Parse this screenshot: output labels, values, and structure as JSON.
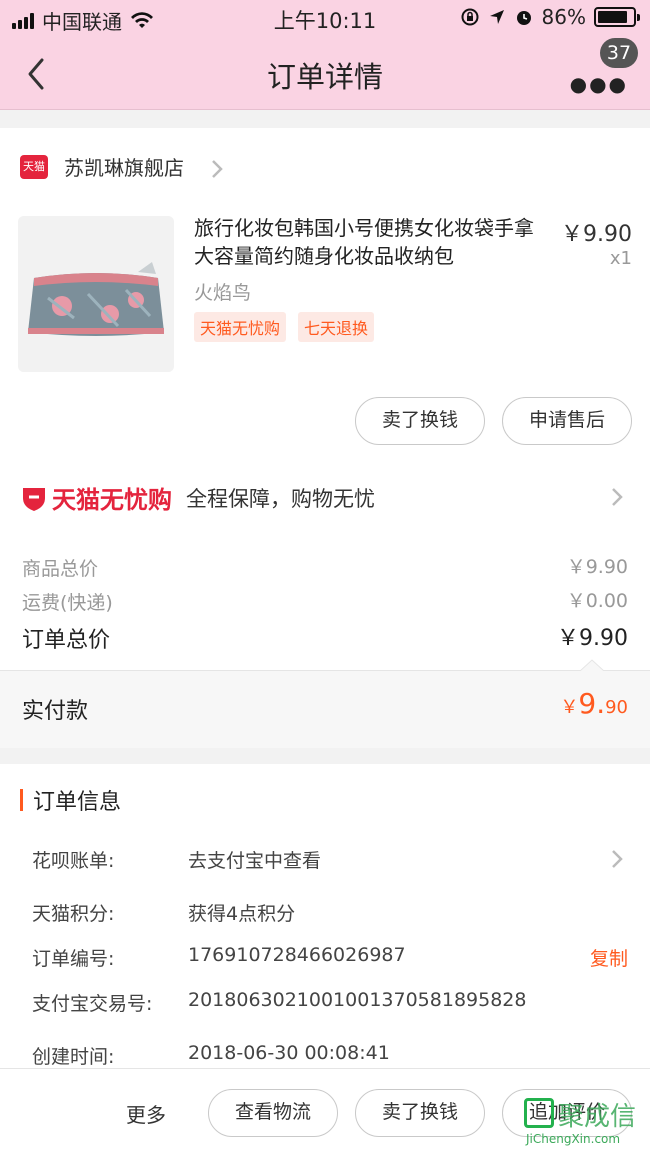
{
  "status_bar": {
    "carrier": "中国联通",
    "time": "上午10:11",
    "battery_percent": "86%",
    "battery_level": 0.86
  },
  "nav": {
    "title": "订单详情",
    "badge_count": "37"
  },
  "shop": {
    "logo_text": "天猫",
    "name": "苏凯琳旗舰店"
  },
  "product": {
    "title": "旅行化妆包韩国小号便携女化妆袋手拿大容量简约随身化妆品收纳包",
    "price": "￥9.90",
    "quantity": "x1",
    "spec": "火焰鸟",
    "tags": [
      "天猫无忧购",
      "七天退换"
    ]
  },
  "actions": {
    "sell": "卖了换钱",
    "after_sale": "申请售后"
  },
  "guarantee": {
    "brand": "天猫无忧购",
    "text": "全程保障，购物无忧"
  },
  "price_summary": {
    "goods_label": "商品总价",
    "goods_value": "￥9.90",
    "shipping_label": "运费(快递)",
    "shipping_value": "￥0.00",
    "total_label": "订单总价",
    "total_value": "￥9.90",
    "paid_label": "实付款",
    "paid_symbol": "￥",
    "paid_integer": "9.",
    "paid_decimal": "90"
  },
  "order_info": {
    "title": "订单信息",
    "rows": [
      {
        "label": "花呗账单:",
        "value": "去支付宝中查看"
      },
      {
        "label": "天猫积分:",
        "value": "获得4点积分"
      },
      {
        "label": "订单编号:",
        "value": "176910728466026987"
      },
      {
        "label": "支付宝交易号:",
        "value": "2018063021001001370581895828"
      },
      {
        "label": "创建时间:",
        "value": "2018-06-30 00:08:41"
      }
    ],
    "copy_label": "复制"
  },
  "footer": {
    "more": "更多",
    "logistics": "查看物流",
    "sell": "卖了换钱",
    "review": "追加评价"
  },
  "watermark": {
    "text": "聚成信",
    "url": "JiChengXin.com"
  },
  "colors": {
    "header_pink": "#fad3e3",
    "accent_orange": "#ff5a1f",
    "tmall_red": "#e4243d"
  }
}
